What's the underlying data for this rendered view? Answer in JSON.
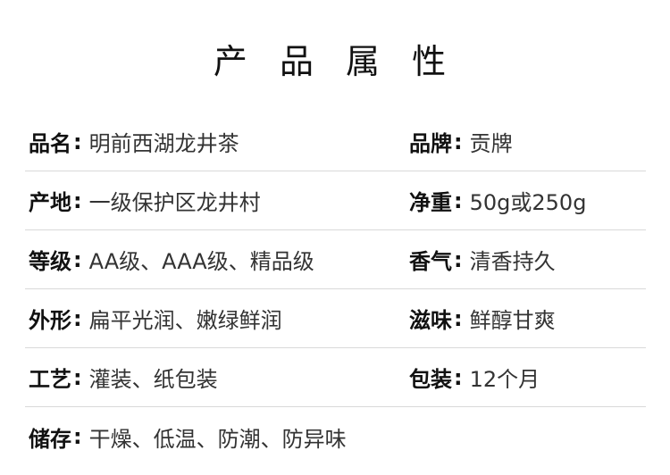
{
  "title": "产 品 属 性",
  "rows": [
    {
      "left": {
        "label": "品名",
        "value": "明前西湖龙井茶"
      },
      "right": {
        "label": "品牌",
        "value": "贡牌"
      }
    },
    {
      "left": {
        "label": "产地",
        "value": "一级保护区龙井村"
      },
      "right": {
        "label": "净重",
        "value": "50g或250g"
      }
    },
    {
      "left": {
        "label": "等级",
        "value": "AA级、AAA级、精品级"
      },
      "right": {
        "label": "香气",
        "value": "清香持久"
      }
    },
    {
      "left": {
        "label": "外形",
        "value": "扁平光润、嫩绿鲜润"
      },
      "right": {
        "label": "滋味",
        "value": "鲜醇甘爽"
      }
    },
    {
      "left": {
        "label": "工艺",
        "value": "灌装、纸包装"
      },
      "right": {
        "label": "包装",
        "value": "12个月"
      }
    },
    {
      "left": {
        "label": "储存",
        "value": "干燥、低温、防潮、防异味"
      }
    }
  ],
  "separator": ":"
}
